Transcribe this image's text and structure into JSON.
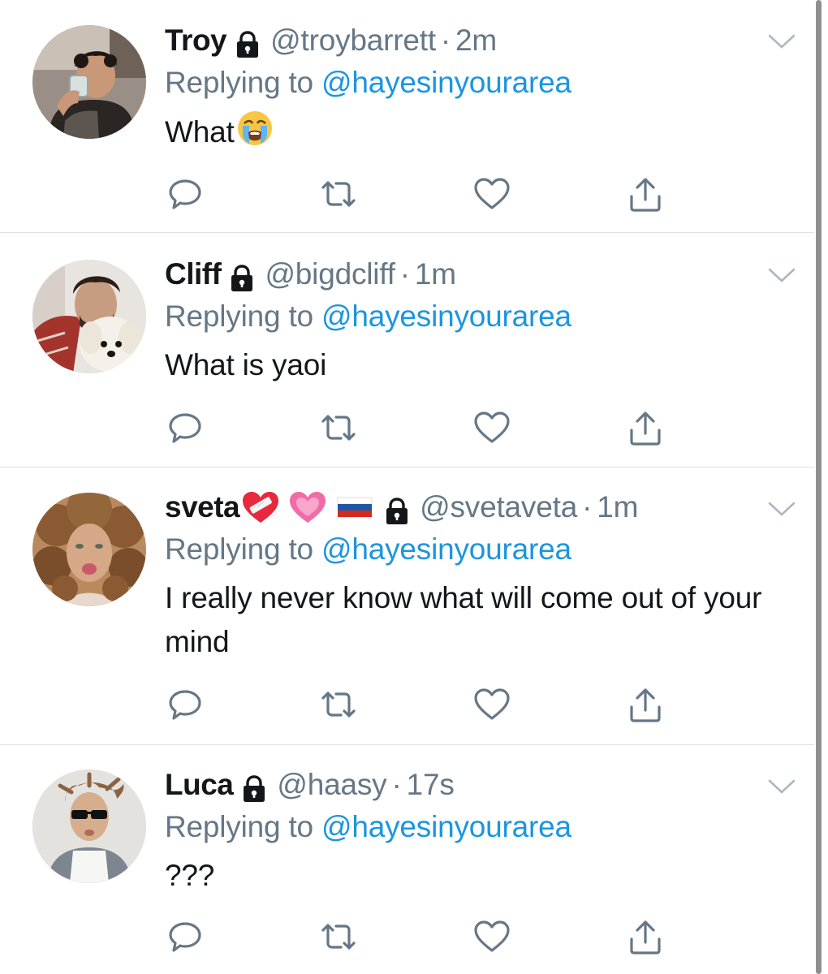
{
  "tweets": [
    {
      "name": "Troy",
      "name_emojis": [],
      "handle": "@troybarrett",
      "time": "2m",
      "replying_prefix": "Replying to",
      "replying_to": "@hayesinyourarea",
      "text": "What",
      "text_emoji": "loudly-crying-face"
    },
    {
      "name": "Cliff",
      "name_emojis": [],
      "handle": "@bigdcliff",
      "time": "1m",
      "replying_prefix": "Replying to",
      "replying_to": "@hayesinyourarea",
      "text": "What is yaoi",
      "text_emoji": ""
    },
    {
      "name": "sveta",
      "name_emojis": [
        "mending-heart",
        "growing-heart",
        "russia-flag"
      ],
      "handle": "@svetaveta",
      "time": "1m",
      "replying_prefix": "Replying to",
      "replying_to": "@hayesinyourarea",
      "text": "I really never know what will come out of your mind",
      "text_emoji": ""
    },
    {
      "name": "Luca",
      "name_emojis": [],
      "handle": "@haasy",
      "time": "17s",
      "replying_prefix": "Replying to",
      "replying_to": "@hayesinyourarea",
      "text": "???",
      "text_emoji": ""
    }
  ],
  "icons": {
    "protected": "lock-icon",
    "menu": "chevron-down-icon",
    "reply": "reply-icon",
    "retweet": "retweet-icon",
    "like": "heart-icon",
    "share": "share-icon"
  },
  "colors": {
    "name": "#14171a",
    "secondary": "#657786",
    "link": "#1b95e0",
    "action_icon": "#657786",
    "divider": "#dde1e4"
  }
}
